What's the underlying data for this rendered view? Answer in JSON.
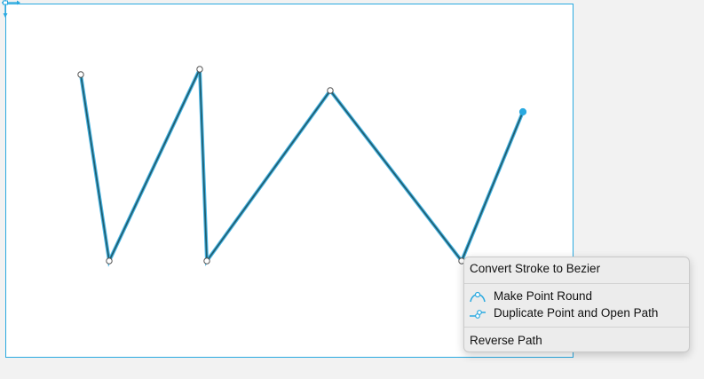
{
  "context_menu": {
    "groups": [
      [
        {
          "label": "Convert Stroke to Bezier",
          "icon": null
        }
      ],
      [
        {
          "label": "Make Point Round",
          "icon": "round-point-icon"
        },
        {
          "label": "Duplicate Point and Open Path",
          "icon": "duplicate-point-icon"
        }
      ],
      [
        {
          "label": "Reverse Path",
          "icon": null
        }
      ]
    ]
  },
  "path": {
    "stroke_color": "#1f5f72",
    "selection_color": "#29a9e0",
    "selected_point_index": 6
  },
  "colors": {
    "accent": "#29a9e0",
    "artboard_border": "#29a9e0"
  }
}
